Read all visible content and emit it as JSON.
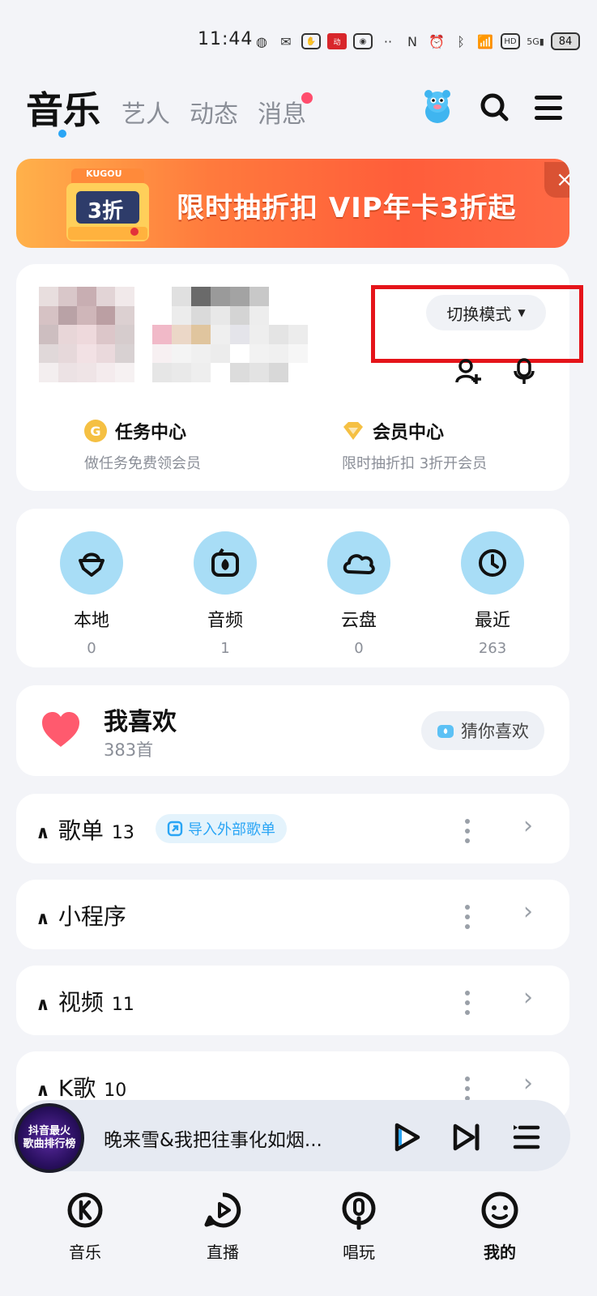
{
  "status_bar": {
    "time": "11:44",
    "battery": "84",
    "network": "5G",
    "hd": "HD"
  },
  "header": {
    "tabs": [
      {
        "label": "音乐",
        "active": true
      },
      {
        "label": "艺人"
      },
      {
        "label": "动态"
      },
      {
        "label": "消息",
        "badge": true
      }
    ],
    "icons": [
      "mascot-icon",
      "search-icon",
      "menu-icon"
    ]
  },
  "banner": {
    "text": "限时抽折扣 VIP年卡3折起",
    "brand": "KUGOU",
    "badge": "3折",
    "close": "×"
  },
  "profile": {
    "switch_mode": "切换模式",
    "task_center": {
      "title": "任务中心",
      "subtitle": "做任务免费领会员",
      "icon": "G"
    },
    "vip_center": {
      "title": "会员中心",
      "subtitle": "限时抽折扣 3折开会员"
    }
  },
  "quick_access": [
    {
      "label": "本地",
      "count": "0",
      "icon": "local-icon"
    },
    {
      "label": "音频",
      "count": "1",
      "icon": "audio-icon"
    },
    {
      "label": "云盘",
      "count": "0",
      "icon": "cloud-icon"
    },
    {
      "label": "最近",
      "count": "263",
      "icon": "recent-icon"
    }
  ],
  "favorites": {
    "title": "我喜欢",
    "count": "383首",
    "guess_button": "猜你喜欢"
  },
  "sections": [
    {
      "title": "歌单",
      "count": "13",
      "import_label": "导入外部歌单"
    },
    {
      "title": "小程序",
      "count": ""
    },
    {
      "title": "视频",
      "count": "11"
    },
    {
      "title": "K歌",
      "count": "10"
    }
  ],
  "player": {
    "song": "晚来雪&我把往事化如烟...",
    "album_line1": "抖音最火",
    "album_line2": "歌曲排行榜"
  },
  "bottom_nav": [
    {
      "label": "音乐"
    },
    {
      "label": "直播"
    },
    {
      "label": "唱玩"
    },
    {
      "label": "我的",
      "active": true
    }
  ],
  "colors": {
    "accent": "#2aa5f5",
    "heart": "#ff5a6e",
    "highlight_frame": "#e5141a"
  }
}
